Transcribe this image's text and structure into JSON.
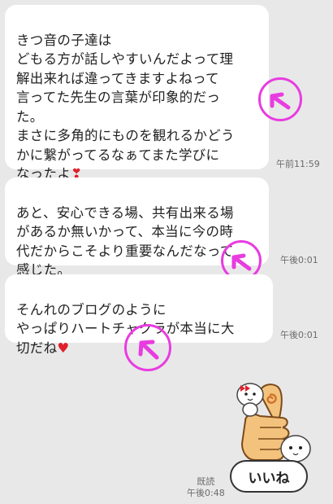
{
  "messages": [
    {
      "text": "きつ音の子達は\nどもる方が話しやすいんだよって理\n解出来れば違ってきますよねって\n言ってた先生の言葉が印象的だっ\nた。\nまさに多角的にものを観れるかどう\nかに繋がってるなぁてまた学びに\nなったよ",
      "emoji": "❣",
      "time": "午前11:59"
    },
    {
      "text": "あと、安心できる場、共有出来る場\nがあるか無いかって、本当に今の時\n代だからこそより重要なんだなって\n感じた。",
      "time": "午後0:01"
    },
    {
      "text": "そんれのブログのように\nやっぱりハートチャクラが本当に大\n切だね",
      "emoji": "♥",
      "time": "午後0:01"
    }
  ],
  "sticker": {
    "caption": "いいね"
  },
  "receipt": {
    "read_label": "既読",
    "time": "午後0:48"
  },
  "colors": {
    "annotation": "#e83ce0",
    "bubble": "#ffffff",
    "background": "#e8e8e8"
  }
}
